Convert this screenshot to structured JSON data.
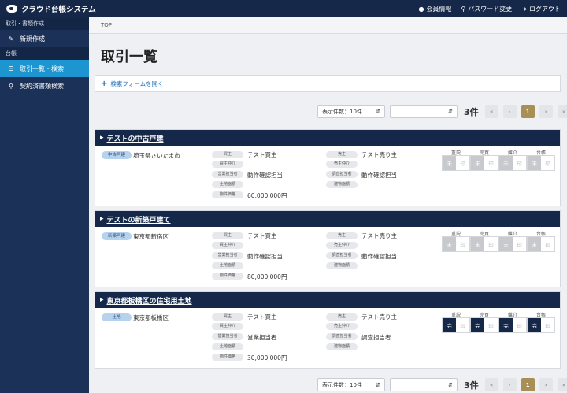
{
  "app": {
    "title": "クラウド台帳システム",
    "nav": [
      {
        "icon": "user-icon",
        "label": "会員情報"
      },
      {
        "icon": "key-icon",
        "label": "パスワード変更"
      },
      {
        "icon": "logout-icon",
        "label": "ログアウト"
      }
    ]
  },
  "sidebar": {
    "sections": [
      {
        "title": "取引・書類作成",
        "items": [
          {
            "icon": "edit-icon",
            "label": "新規作成",
            "active": false
          }
        ]
      },
      {
        "title": "台帳",
        "items": [
          {
            "icon": "list-icon",
            "label": "取引一覧・検索",
            "active": true
          },
          {
            "icon": "search-icon",
            "label": "契約済書類検索",
            "active": false
          }
        ]
      }
    ]
  },
  "breadcrumb": "TOP",
  "page_title": "取引一覧",
  "search_toggle": {
    "plus": "+",
    "label": "検索フォームを開く"
  },
  "pager": {
    "per_page": "表示件数：10件",
    "second_select": "",
    "count": "3件",
    "first": "«",
    "prev": "‹",
    "current": "1",
    "next": "›",
    "last": "»"
  },
  "stage_headers": [
    "重説",
    "売買",
    "媒介",
    "台帳"
  ],
  "labels": {
    "buyer": "買主",
    "buyer_agent": "買主仲介",
    "sales_staff": "営業担当者",
    "land_area": "土地面積",
    "price": "物件価格",
    "seller": "売主",
    "seller_agent": "売主仲介",
    "survey_staff": "調査担当者",
    "building_area": "建物面積",
    "done": "完",
    "unfinished": "未",
    "seal": "印"
  },
  "records": [
    {
      "title": "テストの中古戸建",
      "type": "中古戸建",
      "address": "埼玉県さいたま市",
      "buyer": "テスト買主",
      "sales_staff": "動作確認担当",
      "price": "60,000,000円",
      "seller": "テスト売り主",
      "survey_staff": "動作確認担当",
      "stages": [
        "未",
        "未",
        "未",
        "未"
      ]
    },
    {
      "title": "テストの新築戸建て",
      "type": "新築戸建",
      "address": "東京都新宿区",
      "buyer": "テスト買主",
      "sales_staff": "動作確認担当",
      "price": "80,000,000円",
      "seller": "テスト売り主",
      "survey_staff": "動作確認担当",
      "stages": [
        "未",
        "未",
        "未",
        "未"
      ]
    },
    {
      "title": "東京都板橋区の住宅用土地",
      "type": "土地",
      "address": "東京都板橋区",
      "buyer": "テスト買主",
      "sales_staff": "営業担当者",
      "price": "30,000,000円",
      "seller": "テスト売り主",
      "survey_staff": "調査担当者",
      "stages": [
        "完",
        "完",
        "完",
        "完"
      ]
    }
  ]
}
